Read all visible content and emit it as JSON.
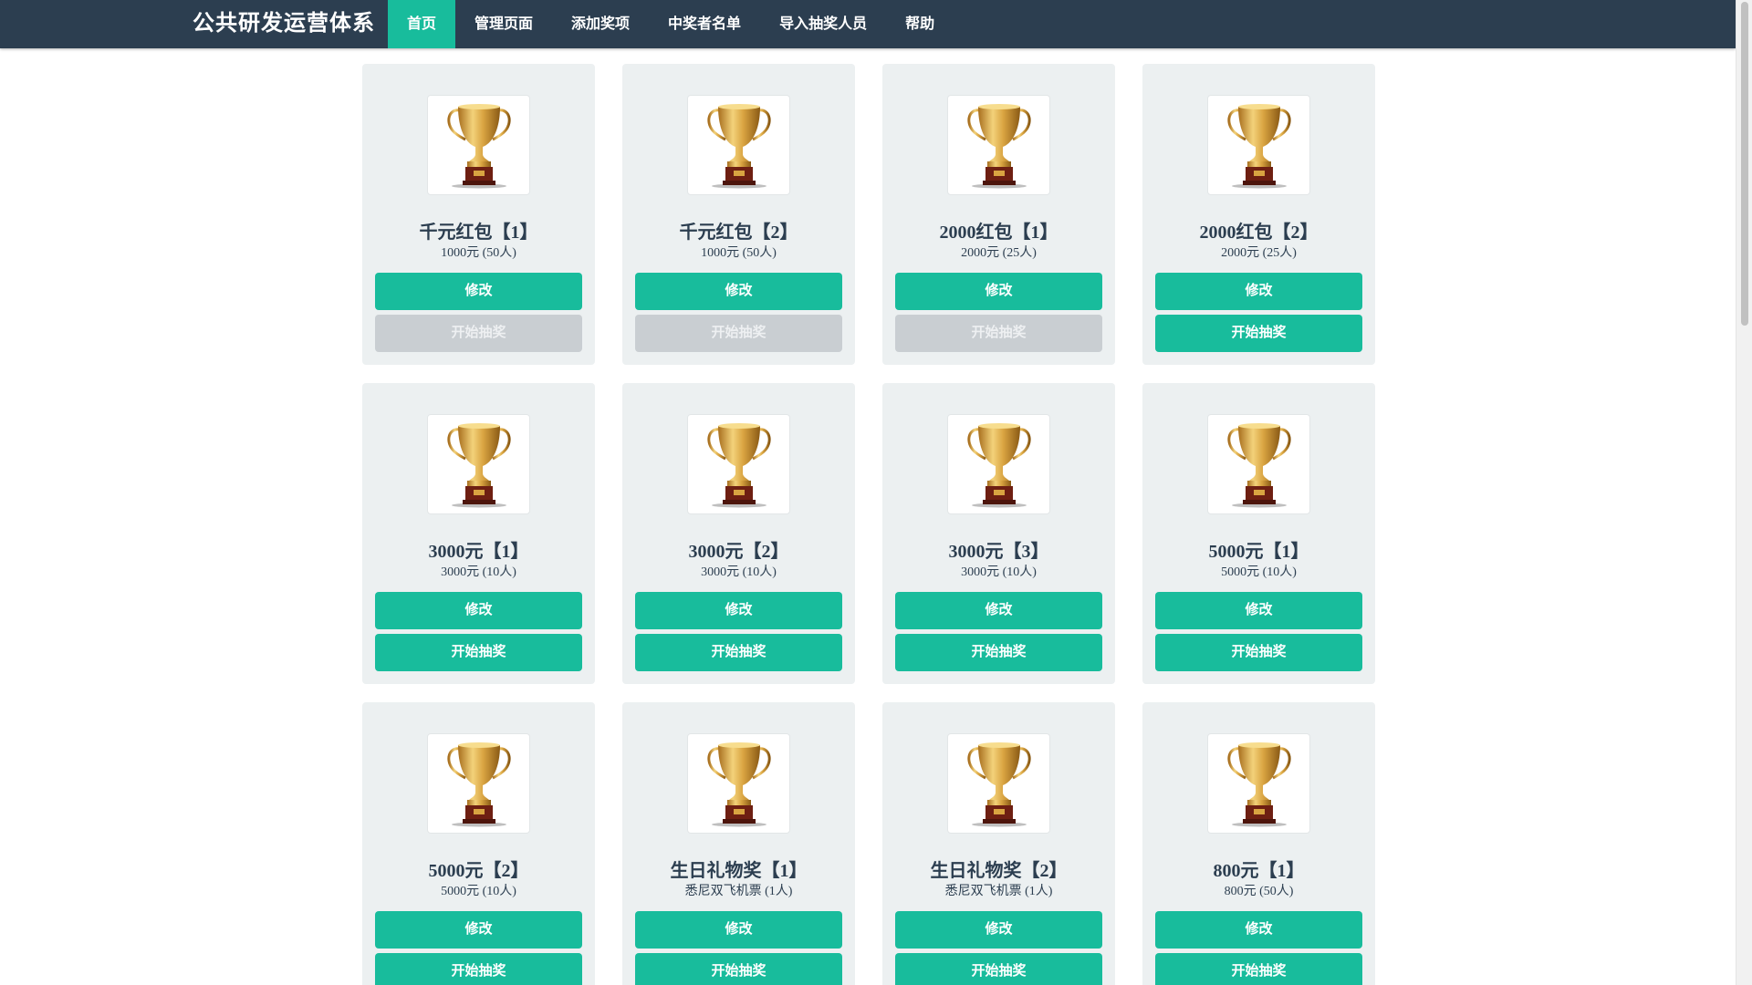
{
  "app": {
    "title": "公共研发运营体系"
  },
  "nav": [
    {
      "label": "首页",
      "active": true
    },
    {
      "label": "管理页面",
      "active": false
    },
    {
      "label": "添加奖项",
      "active": false
    },
    {
      "label": "中奖者名单",
      "active": false
    },
    {
      "label": "导入抽奖人员",
      "active": false
    },
    {
      "label": "帮助",
      "active": false
    }
  ],
  "prizes": [
    {
      "title": "千元红包【1】",
      "subtitle": "1000元 (50人)",
      "edit_label": "修改",
      "draw_label": "开始抽奖",
      "draw_enabled": false,
      "icon": "trophy-icon"
    },
    {
      "title": "千元红包【2】",
      "subtitle": "1000元 (50人)",
      "edit_label": "修改",
      "draw_label": "开始抽奖",
      "draw_enabled": false,
      "icon": "trophy-icon"
    },
    {
      "title": "2000红包【1】",
      "subtitle": "2000元 (25人)",
      "edit_label": "修改",
      "draw_label": "开始抽奖",
      "draw_enabled": false,
      "icon": "trophy-icon"
    },
    {
      "title": "2000红包【2】",
      "subtitle": "2000元 (25人)",
      "edit_label": "修改",
      "draw_label": "开始抽奖",
      "draw_enabled": true,
      "icon": "trophy-icon"
    },
    {
      "title": "3000元【1】",
      "subtitle": "3000元 (10人)",
      "edit_label": "修改",
      "draw_label": "开始抽奖",
      "draw_enabled": true,
      "icon": "trophy-icon"
    },
    {
      "title": "3000元【2】",
      "subtitle": "3000元 (10人)",
      "edit_label": "修改",
      "draw_label": "开始抽奖",
      "draw_enabled": true,
      "icon": "trophy-icon"
    },
    {
      "title": "3000元【3】",
      "subtitle": "3000元 (10人)",
      "edit_label": "修改",
      "draw_label": "开始抽奖",
      "draw_enabled": true,
      "icon": "trophy-icon"
    },
    {
      "title": "5000元【1】",
      "subtitle": "5000元 (10人)",
      "edit_label": "修改",
      "draw_label": "开始抽奖",
      "draw_enabled": true,
      "icon": "trophy-icon"
    },
    {
      "title": "5000元【2】",
      "subtitle": "5000元 (10人)",
      "edit_label": "修改",
      "draw_label": "开始抽奖",
      "draw_enabled": true,
      "icon": "trophy-icon"
    },
    {
      "title": "生日礼物奖【1】",
      "subtitle": "悉尼双飞机票 (1人)",
      "edit_label": "修改",
      "draw_label": "开始抽奖",
      "draw_enabled": true,
      "icon": "trophy-icon"
    },
    {
      "title": "生日礼物奖【2】",
      "subtitle": "悉尼双飞机票 (1人)",
      "edit_label": "修改",
      "draw_label": "开始抽奖",
      "draw_enabled": true,
      "icon": "trophy-icon"
    },
    {
      "title": "800元【1】",
      "subtitle": "800元 (50人)",
      "edit_label": "修改",
      "draw_label": "开始抽奖",
      "draw_enabled": true,
      "icon": "trophy-icon"
    }
  ],
  "colors": {
    "navbar": "#2c3e50",
    "accent": "#18bc9c",
    "card": "#ecf0f1",
    "disabled": "#c9ced2"
  }
}
